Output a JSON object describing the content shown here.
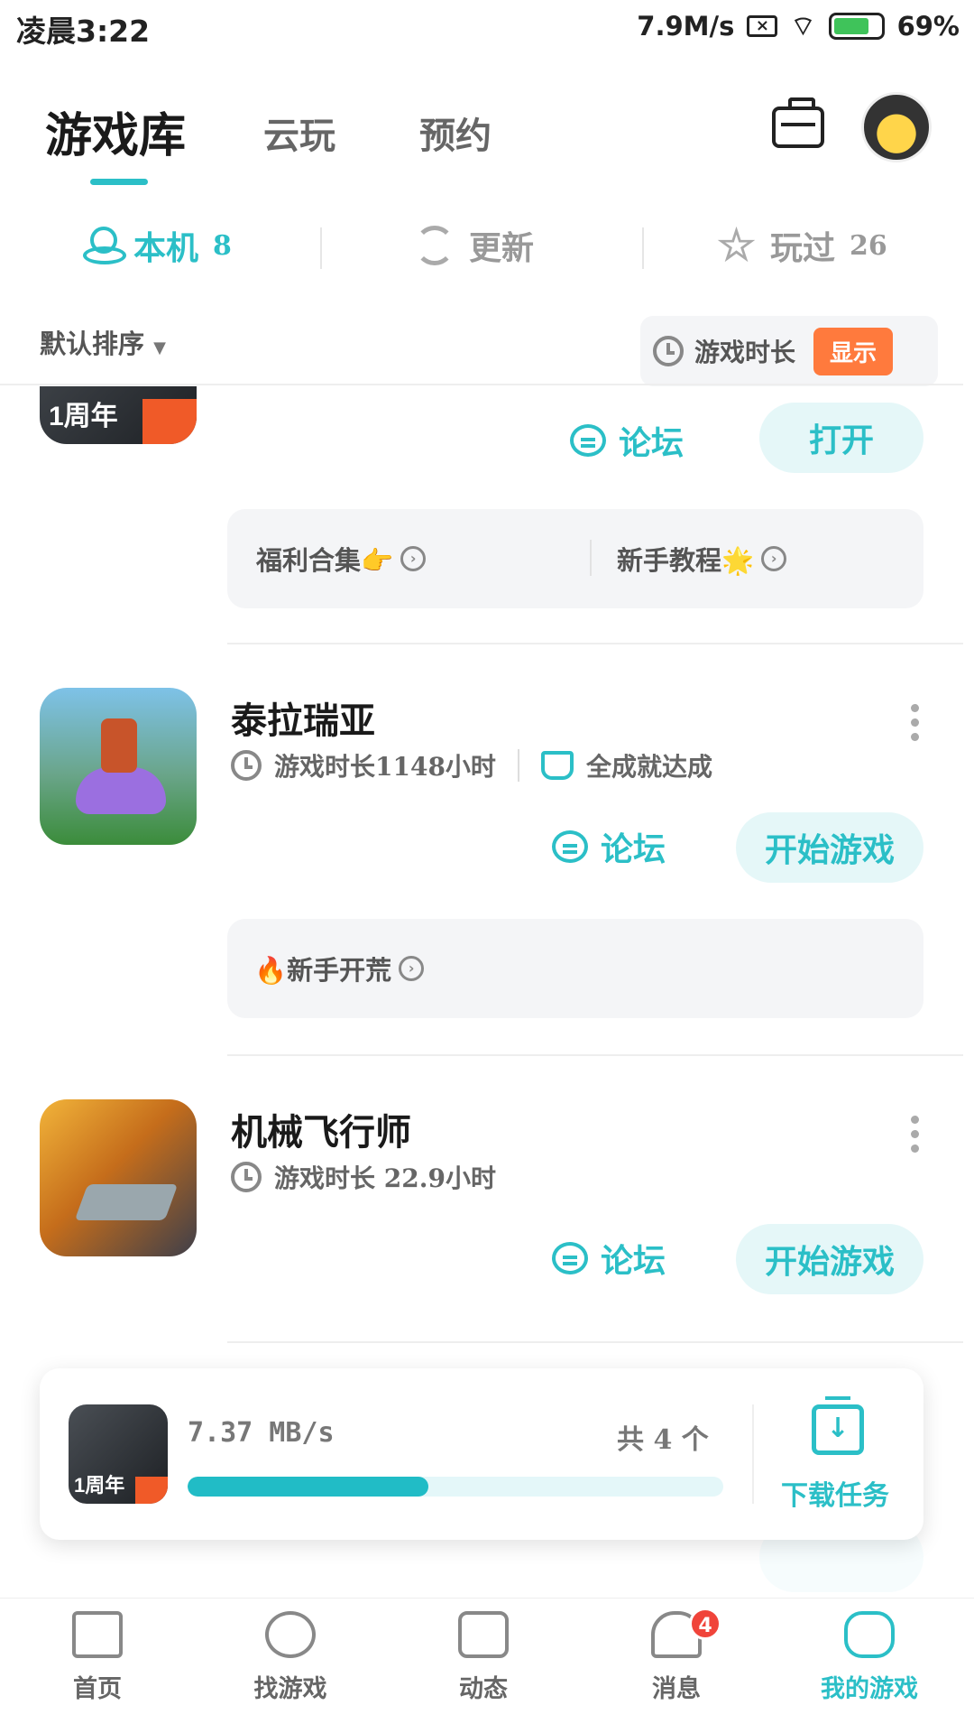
{
  "status_bar": {
    "time": "凌晨3:22",
    "net_speed": "7.9M/s",
    "battery": "69%"
  },
  "top_tabs": [
    {
      "label": "游戏库",
      "active": true
    },
    {
      "label": "云玩",
      "active": false
    },
    {
      "label": "预约",
      "active": false
    }
  ],
  "sub_tabs": [
    {
      "label": "本机",
      "count": "8",
      "active": true
    },
    {
      "label": "更新",
      "count": "",
      "active": false
    },
    {
      "label": "玩过",
      "count": "26",
      "active": false
    }
  ],
  "sort": {
    "label": "默认排序",
    "playtime_label": "游戏时长",
    "show_button": "显示"
  },
  "games": [
    {
      "name": "",
      "icon_badge": "1周年",
      "forum": "论坛",
      "action": "打开",
      "perks": [
        {
          "label": "福利合集👉"
        },
        {
          "label": "新手教程🌟"
        }
      ]
    },
    {
      "name": "泰拉瑞亚",
      "playtime": "游戏时长1148小时",
      "achievement": "全成就达成",
      "forum": "论坛",
      "action": "开始游戏",
      "perks": [
        {
          "label": "🔥新手开荒"
        }
      ]
    },
    {
      "name": "机械飞行师",
      "playtime": "游戏时长 22.9小时",
      "forum": "论坛",
      "action": "开始游戏"
    }
  ],
  "download": {
    "speed": "7.37 MB/s",
    "count_label": "共 4 个",
    "progress": 0.45,
    "task_label": "下载任务",
    "icon_badge": "1周年"
  },
  "bottom_nav": [
    {
      "label": "首页",
      "icon": "home-icon"
    },
    {
      "label": "找游戏",
      "icon": "planet-icon"
    },
    {
      "label": "动态",
      "icon": "feed-icon"
    },
    {
      "label": "消息",
      "icon": "bell-icon",
      "badge": "4"
    },
    {
      "label": "我的游戏",
      "icon": "gamepad-icon",
      "active": true
    }
  ],
  "colors": {
    "accent": "#2bbfc7",
    "show_button": "#ff7a3d",
    "badge": "#f0443a"
  }
}
